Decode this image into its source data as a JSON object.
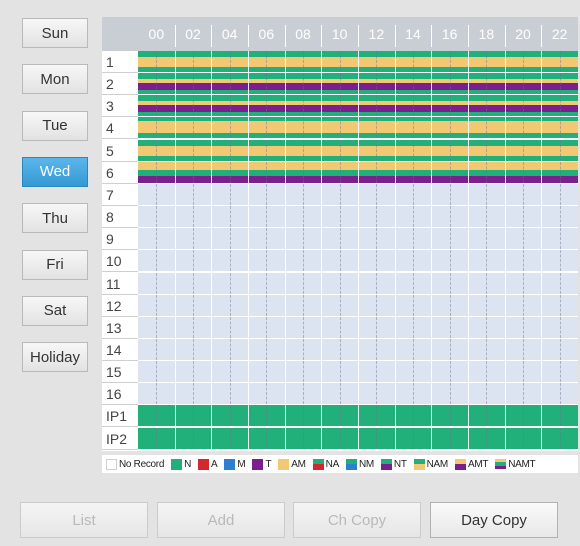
{
  "days": [
    {
      "label": "Sun",
      "active": false
    },
    {
      "label": "Mon",
      "active": false
    },
    {
      "label": "Tue",
      "active": false
    },
    {
      "label": "Wed",
      "active": true
    },
    {
      "label": "Thu",
      "active": false
    },
    {
      "label": "Fri",
      "active": false
    },
    {
      "label": "Sat",
      "active": false
    },
    {
      "label": "Holiday",
      "active": false
    }
  ],
  "hours": [
    "00",
    "02",
    "04",
    "06",
    "08",
    "10",
    "12",
    "14",
    "16",
    "18",
    "20",
    "22"
  ],
  "colors": {
    "header_bg": "#c9ced4",
    "empty": "#dbe4f0",
    "N": "#22b07a",
    "A": "#d4262b",
    "M": "#2f7fd1",
    "T": "#7b1f8f",
    "AM": "#f2c873",
    "active_day": "#3a9ed8"
  },
  "channels": [
    {
      "label": "1",
      "pattern": "NAM"
    },
    {
      "label": "2",
      "pattern": "NT"
    },
    {
      "label": "3",
      "pattern": "NT"
    },
    {
      "label": "4",
      "pattern": "AM"
    },
    {
      "label": "5",
      "pattern": "NAM"
    },
    {
      "label": "6",
      "pattern": "AMT"
    },
    {
      "label": "7",
      "pattern": "none"
    },
    {
      "label": "8",
      "pattern": "none"
    },
    {
      "label": "9",
      "pattern": "none"
    },
    {
      "label": "10",
      "pattern": "none"
    },
    {
      "label": "11",
      "pattern": "none"
    },
    {
      "label": "12",
      "pattern": "none"
    },
    {
      "label": "13",
      "pattern": "none"
    },
    {
      "label": "14",
      "pattern": "none"
    },
    {
      "label": "15",
      "pattern": "none"
    },
    {
      "label": "16",
      "pattern": "none"
    },
    {
      "label": "IP1",
      "pattern": "N"
    },
    {
      "label": "IP2",
      "pattern": "N"
    }
  ],
  "legend": [
    {
      "label": "No Record",
      "swatch": [
        "none"
      ]
    },
    {
      "label": "N",
      "swatch": [
        "N"
      ]
    },
    {
      "label": "A",
      "swatch": [
        "A"
      ]
    },
    {
      "label": "M",
      "swatch": [
        "M"
      ]
    },
    {
      "label": "T",
      "swatch": [
        "T"
      ]
    },
    {
      "label": "AM",
      "swatch": [
        "AM"
      ]
    },
    {
      "label": "NA",
      "swatch": [
        "N",
        "A"
      ]
    },
    {
      "label": "NM",
      "swatch": [
        "N",
        "M"
      ]
    },
    {
      "label": "NT",
      "swatch": [
        "N",
        "T"
      ]
    },
    {
      "label": "NAM",
      "swatch": [
        "N",
        "AM"
      ]
    },
    {
      "label": "AMT",
      "swatch": [
        "AM",
        "T"
      ]
    },
    {
      "label": "NAMT",
      "swatch": [
        "AM",
        "N",
        "T"
      ]
    }
  ],
  "buttons": {
    "list": "List",
    "add": "Add",
    "ch_copy": "Ch Copy",
    "day_copy": "Day Copy"
  }
}
